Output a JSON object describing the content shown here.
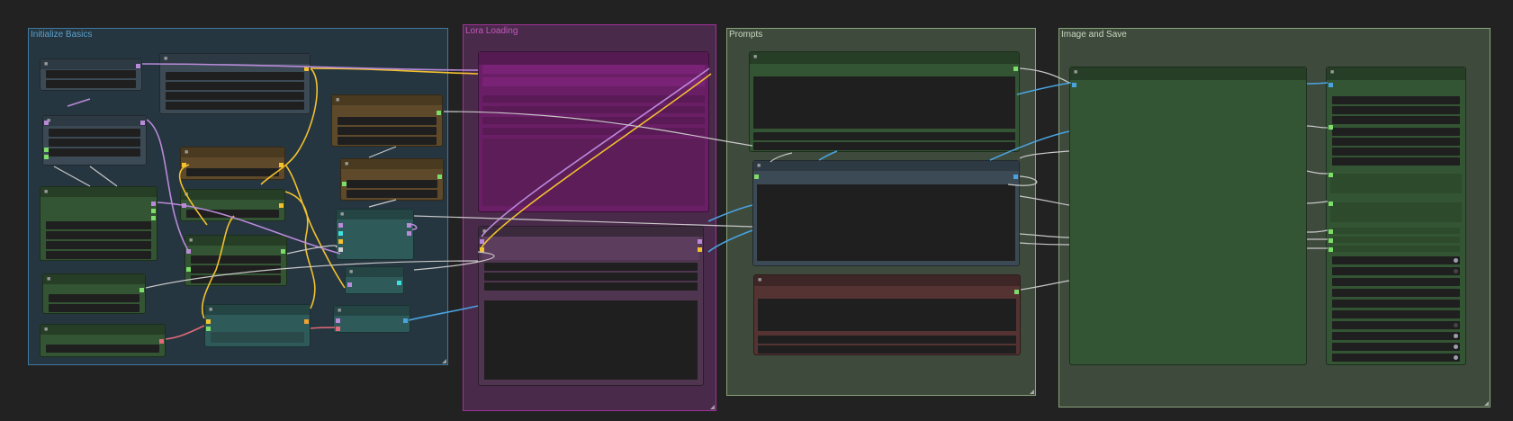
{
  "canvas": {
    "background": "#222222"
  },
  "groups": [
    {
      "title": "Initialize Basics",
      "color": "#3f789e"
    },
    {
      "title": "Lora Loading",
      "color": "#a1309b"
    },
    {
      "title": "Prompts",
      "color": "#8aa37a"
    },
    {
      "title": "Image and Save",
      "color": "#8aa37a"
    }
  ],
  "node_collapse_glyph": "■",
  "colors": {
    "slate_node": "#3c4a55",
    "green_node": "#335533",
    "brown_node": "#5e4a2a",
    "teal_node": "#2f5a5a",
    "magenta_node": "#6a1e66",
    "red_node": "#553333",
    "link_yellow": "#f2c12e",
    "link_lavender": "#b98ad9",
    "link_blue": "#4aa3e0",
    "link_white": "#c8c8c8",
    "link_pink": "#e06a7a"
  }
}
